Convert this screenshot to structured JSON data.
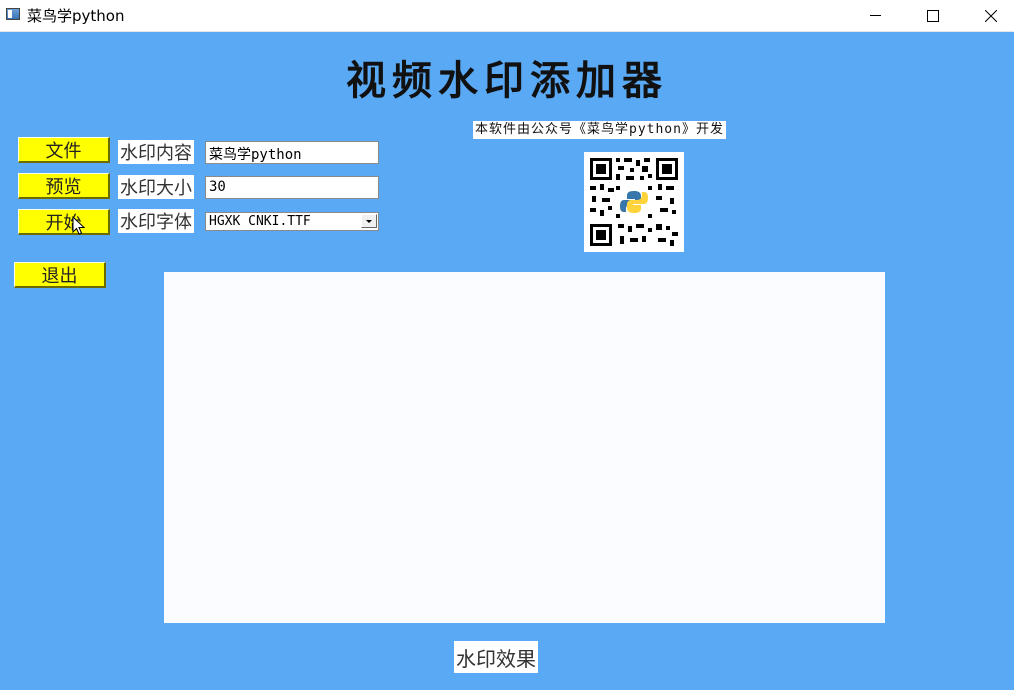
{
  "window": {
    "title": "菜鸟学python",
    "controls": {
      "minimize": "minimize",
      "maximize": "maximize",
      "close": "close"
    }
  },
  "header": {
    "title": "视频水印添加器",
    "credit": "本软件由公众号《菜鸟学python》开发"
  },
  "buttons": {
    "file": "文件",
    "preview": "预览",
    "start": "开始",
    "exit": "退出"
  },
  "fields": {
    "content_label": "水印内容",
    "content_value": "菜鸟学python",
    "size_label": "水印大小",
    "size_value": "30",
    "font_label": "水印字体",
    "font_value": "HGXK CNKI.TTF"
  },
  "preview": {
    "caption": "水印效果"
  },
  "colors": {
    "background": "#5aa9f5",
    "button": "#ffff00",
    "canvas": "#fbfcff"
  },
  "icons": {
    "qr": "qr-code-icon",
    "cursor": "mouse-cursor-icon",
    "app": "window-app-icon"
  }
}
